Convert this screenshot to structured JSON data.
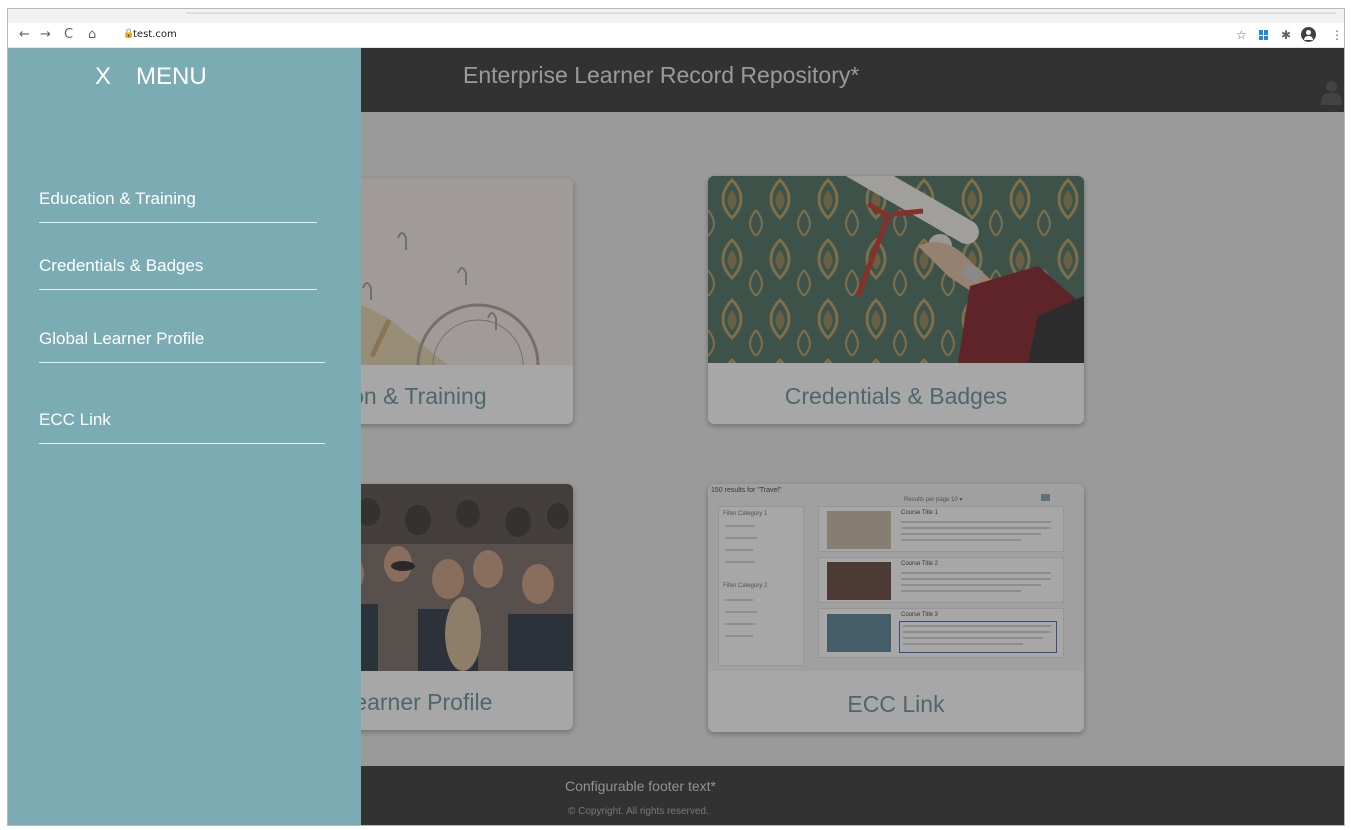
{
  "browser": {
    "nav_icons": {
      "back": "←",
      "forward": "→",
      "reload": "C",
      "home": "⌂"
    },
    "lock_icon": "🔒",
    "url": "test.com",
    "toolbar_icons": {
      "star": "☆",
      "extensions": "✱",
      "menu": "⋮"
    }
  },
  "header": {
    "title": "Enterprise Learner Record Repository*"
  },
  "menu": {
    "close_label": "X",
    "title": "MENU",
    "items": [
      {
        "label": "Education & Training"
      },
      {
        "label": "Credentials & Badges"
      },
      {
        "label": "Global Learner Profile"
      },
      {
        "label": "ECC Link"
      }
    ]
  },
  "cards": [
    {
      "label": "Education & Training"
    },
    {
      "label": "Credentials & Badges"
    },
    {
      "label": "Global Learner Profile"
    },
    {
      "label": "ECC Link"
    }
  ],
  "ecc_preview": {
    "results": "150 results for \"Travel\"",
    "per_page": "Results per page  10 ▾",
    "filter_category_1": "Filter Category 1",
    "filter_category_2": "Filter Category 2",
    "courses": [
      "Course Title 1",
      "Course Title 2",
      "Course Title 3"
    ]
  },
  "footer": {
    "text": "Configurable footer text*",
    "copyright": "© Copyright. All rights reserved."
  }
}
